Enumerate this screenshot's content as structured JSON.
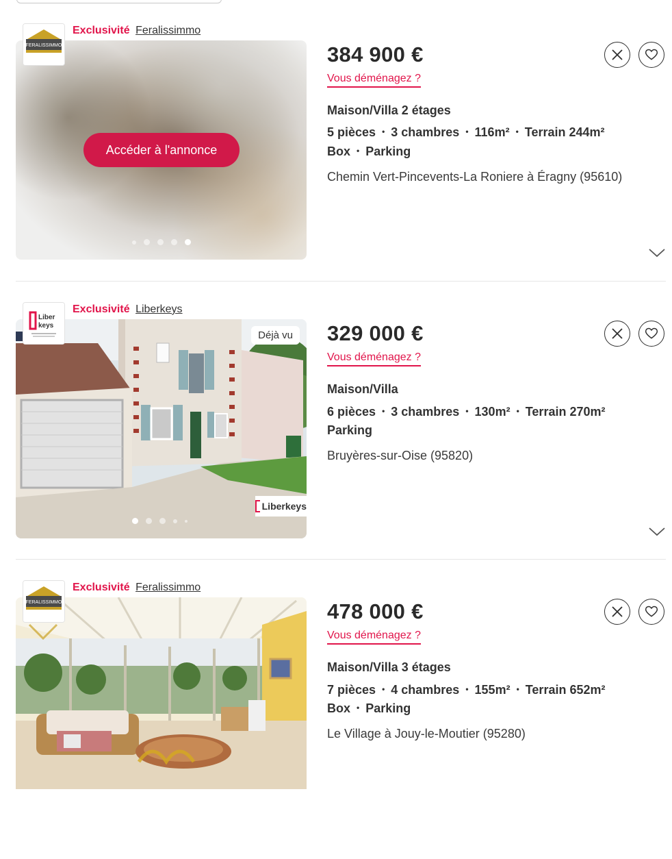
{
  "listings": [
    {
      "exclusivity": "Exclusivité",
      "agency": "Feralissimmo",
      "logo_text": "FERALISSIMMO",
      "price": "384 900 €",
      "moving_link": "Vous déménagez ?",
      "type": "Maison/Villa 2 étages",
      "features_line1": [
        "5 pièces",
        "3 chambres",
        "116m²",
        "Terrain 244m²"
      ],
      "features_line2": [
        "Box",
        "Parking"
      ],
      "location": "Chemin Vert-Pincevents-La Roniere à Éragny (95610)",
      "cta": "Accéder à l'annonce",
      "photo_count": 5,
      "active_photo": 5
    },
    {
      "exclusivity": "Exclusivité",
      "agency": "Liberkeys",
      "logo_text": "Liber keys",
      "price": "329 000 €",
      "moving_link": "Vous déménagez ?",
      "type": "Maison/Villa",
      "features_line1": [
        "6 pièces",
        "3 chambres",
        "130m²",
        "Terrain 270m²"
      ],
      "features_line2": [
        "Parking"
      ],
      "location": "Bruyères-sur-Oise (95820)",
      "seen_badge": "Déjà vu",
      "photo_brand": "Liberkeys",
      "photo_count": 5,
      "active_photo": 1
    },
    {
      "exclusivity": "Exclusivité",
      "agency": "Feralissimmo",
      "logo_text": "FERALISSIMMO",
      "price": "478 000 €",
      "moving_link": "Vous déménagez ?",
      "type": "Maison/Villa 3 étages",
      "features_line1": [
        "7 pièces",
        "4 chambres",
        "155m²",
        "Terrain 652m²"
      ],
      "features_line2": [
        "Box",
        "Parking"
      ],
      "location": "Le Village à Jouy-le-Moutier (95280)"
    }
  ],
  "icons": {
    "hide": "close-icon",
    "favorite": "heart-icon",
    "expand": "chevron-down-icon"
  },
  "colors": {
    "accent": "#e1144a",
    "text": "#2f2f2f",
    "divider": "#e6e6e6"
  }
}
